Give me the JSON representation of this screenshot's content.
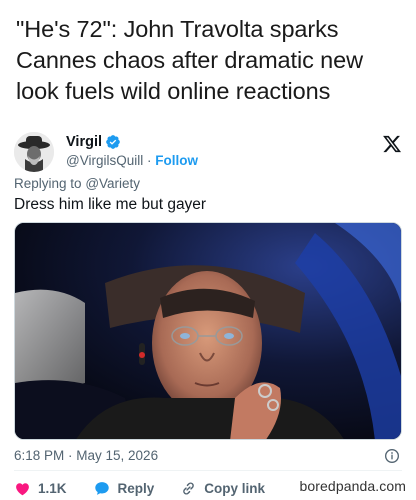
{
  "headline": "\"He's 72\": John Travolta sparks Cannes chaos after dramatic new look fuels wild online reactions",
  "tweet": {
    "display_name": "Virgil",
    "handle": "@VirgilsQuill",
    "separator": "·",
    "follow_label": "Follow",
    "replying_prefix": "Replying to",
    "replying_to": "@Variety",
    "text": "Dress him like me but gayer",
    "timestamp": "6:18 PM · May 15, 2026",
    "likes": "1.1K",
    "reply_label": "Reply",
    "copy_link_label": "Copy link"
  },
  "icons": {
    "verified": "verified-badge-icon",
    "x_logo": "x-logo-icon",
    "info": "info-icon",
    "like": "heart-icon",
    "reply": "speech-bubble-icon",
    "copy_link": "link-icon"
  },
  "colors": {
    "accent": "#1d9bf0",
    "like": "#f91880",
    "muted": "#536471"
  },
  "source": "boredpanda.com"
}
